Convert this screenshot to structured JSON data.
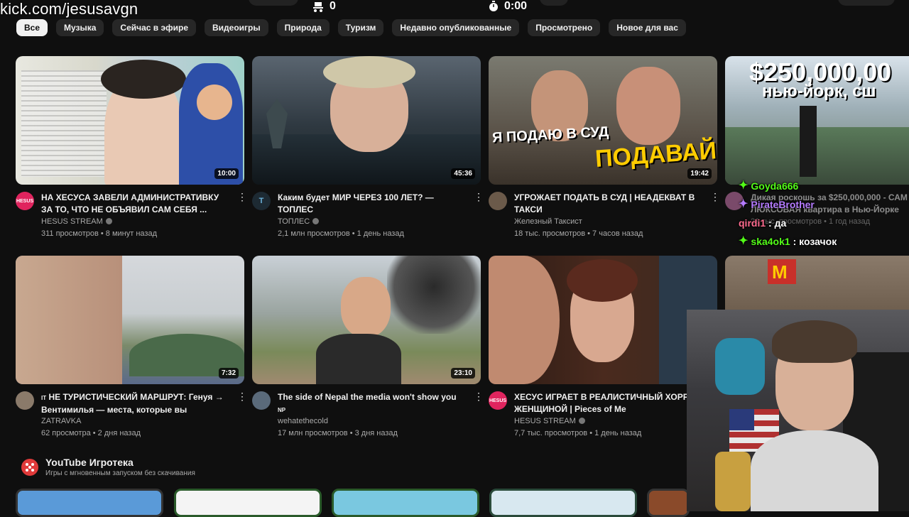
{
  "overlay": {
    "url": "kick.com/jesusavgn",
    "counter": "0",
    "timer": "0:00"
  },
  "chips": [
    "Все",
    "Музыка",
    "Сейчас в эфире",
    "Видеоигры",
    "Природа",
    "Туризм",
    "Недавно опубликованные",
    "Просмотрено",
    "Новое для вас"
  ],
  "videos": [
    {
      "title": "НА ХЕСУСА ЗАВЕЛИ АДМИНИСТРАТИВКУ ЗА ТО, ЧТО НЕ ОБЪЯВИЛ САМ СЕБЯ ...",
      "channel": "HESUS STREAM",
      "stats": "311 просмотров • 8 минут назад",
      "duration": "10:00",
      "avatar_text": "HESUS",
      "avatar_color": "#e0245e"
    },
    {
      "title": "Каким будет МИР ЧЕРЕЗ 100 ЛЕТ? — ТОПЛЕС",
      "channel": "ТОПЛЕС",
      "stats": "2,1 млн просмотров • 1 день назад",
      "duration": "45:36",
      "avatar_text": "T",
      "avatar_color": "#1d2a33"
    },
    {
      "title": "УГРОЖАЕТ ПОДАТЬ В СУД | НЕАДЕКВАТ В ТАКСИ",
      "channel": "Железный Таксист",
      "stats": "18 тыс. просмотров • 7 часов назад",
      "duration": "19:42",
      "avatar_text": "",
      "avatar_color": "#6b5a4a",
      "thumb_text_1": "Я ПОДАЮ В СУД",
      "thumb_text_2": "ПОДАВАЙ"
    },
    {
      "title": "Дикая роскошь за $250,000,000 - САМ ЛЮКСОВАЯ квартира в Нью-Йорке",
      "channel": "",
      "stats": "22 тыс. просмотров • 1 год назад",
      "duration": "",
      "avatar_text": "",
      "avatar_color": "#7a4a6a",
      "thumb_text_1": "$250,000,00",
      "thumb_text_2": "нью-йорк, сш"
    },
    {
      "title": "НЕ ТУРИСТИЧЕСКИЙ МАРШРУТ: Генуя → Вентимилья — места, которые вы пропусти...",
      "channel": "ZATRAVKA",
      "stats": "62 просмотра • 2 дня назад",
      "duration": "7:32",
      "avatar_text": "",
      "avatar_color": "#8a7a6a",
      "prefix": "IT"
    },
    {
      "title": "The side of Nepal the media won't show you",
      "channel": "wehatethecold",
      "stats": "17 млн просмотров • 3 дня назад",
      "duration": "23:10",
      "avatar_text": "",
      "avatar_color": "#5a6a7a",
      "suffix": "NP"
    },
    {
      "title": "ХЕСУС ИГРАЕТ В РЕАЛИСТИЧНЫЙ ХОРРО ЖЕНЩИНОЙ | Pieces of Me",
      "channel": "HESUS STREAM",
      "stats": "7,7 тыс. просмотров • 1 день назад",
      "duration": "",
      "avatar_text": "HESUS",
      "avatar_color": "#e0245e"
    }
  ],
  "playables": {
    "title": "YouTube Игротека",
    "subtitle": "Игры с мгновенным запуском без скачивания"
  },
  "chat": [
    {
      "user": "Goyda666",
      "message": ""
    },
    {
      "user": "PirateBrother",
      "message": ""
    },
    {
      "user": "qirdi1",
      "message": "да"
    },
    {
      "user": "ska4ok1",
      "message": "козачок"
    }
  ],
  "colors": {
    "background": "#0f0f0f",
    "chip": "#272727",
    "chip_active": "#f1f1f1",
    "kick_green": "#53fc18"
  }
}
